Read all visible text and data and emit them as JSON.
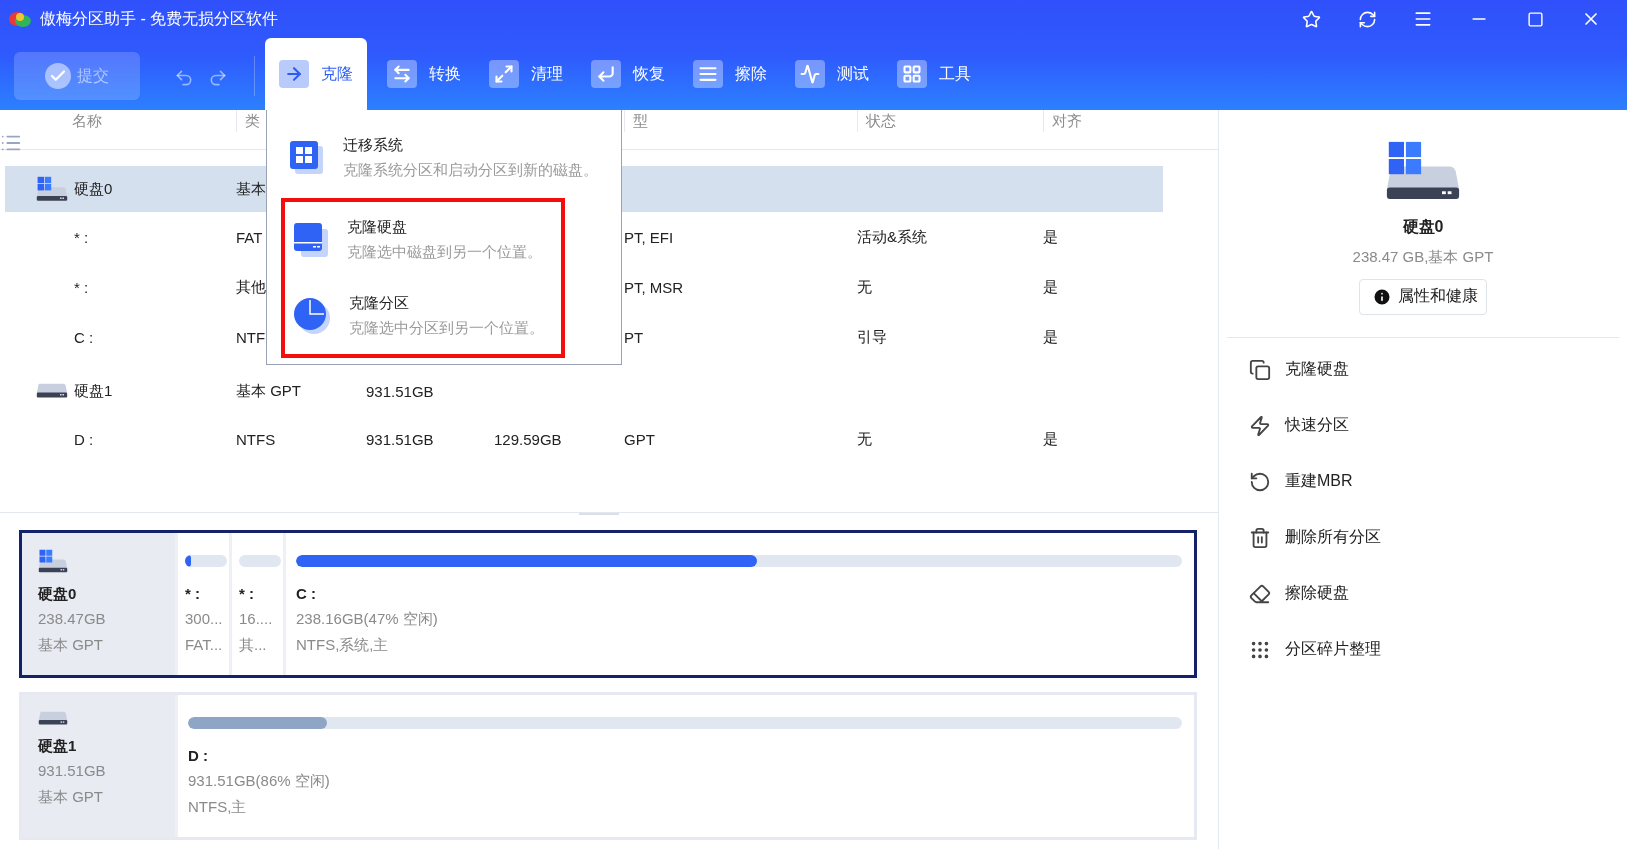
{
  "window": {
    "title": "傲梅分区助手 - 免费无损分区软件"
  },
  "toolbar": {
    "submit": {
      "label": "提交",
      "disabled": true
    },
    "tabs": [
      {
        "label": "克隆",
        "selected": true
      },
      {
        "label": "转换",
        "selected": false
      },
      {
        "label": "清理",
        "selected": false
      },
      {
        "label": "恢复",
        "selected": false
      },
      {
        "label": "擦除",
        "selected": false
      },
      {
        "label": "测试",
        "selected": false
      },
      {
        "label": "工具",
        "selected": false
      }
    ]
  },
  "clone_menu": {
    "items": [
      {
        "title": "迁移系统",
        "description": "克隆系统分区和启动分区到新的磁盘。",
        "highlighted": false
      },
      {
        "title": "克隆硬盘",
        "description": "克隆选中磁盘到另一个位置。",
        "highlighted": true
      },
      {
        "title": "克隆分区",
        "description": "克隆选中分区到另一个位置。",
        "highlighted": true
      }
    ]
  },
  "table": {
    "header": {
      "name": "名称",
      "type": "类",
      "fs": "型",
      "status": "状态",
      "align": "对齐"
    },
    "rows": [
      {
        "kind": "disk",
        "system": true,
        "selected": true,
        "name": "硬盘0",
        "type": "基本"
      },
      {
        "kind": "partition",
        "selected": false,
        "name": "* :",
        "type": "FAT",
        "fs": "PT, EFI",
        "status": "活动&系统",
        "align": "是"
      },
      {
        "kind": "partition",
        "selected": false,
        "name": "* :",
        "type": "其他",
        "fs": "PT, MSR",
        "status": "无",
        "align": "是"
      },
      {
        "kind": "partition",
        "selected": false,
        "name": "C :",
        "type": "NTF",
        "fs": "PT",
        "status": "引导",
        "align": "是"
      },
      {
        "kind": "disk",
        "system": false,
        "selected": false,
        "name": "硬盘1",
        "type": "基本 GPT",
        "capacity": "931.51GB"
      },
      {
        "kind": "partition",
        "selected": false,
        "name": "D :",
        "type": "NTFS",
        "capacity": "931.51GB",
        "used": "129.59GB",
        "fs": "GPT",
        "status": "无",
        "align": "是"
      }
    ]
  },
  "disk_map": [
    {
      "name": "硬盘0",
      "size": "238.47GB",
      "type": "基本 GPT",
      "system": true,
      "selected": true,
      "partitions": [
        {
          "kind": "small",
          "name": "* :",
          "size": "300...",
          "info": "FAT...",
          "level": 0.15
        },
        {
          "kind": "small",
          "name": "* :",
          "size": "16....",
          "info": "其..."
        },
        {
          "kind": "main",
          "name": "C :",
          "size": "238.16GB(47% 空闲)",
          "info": "NTFS,系统,主",
          "level": 0.52
        }
      ]
    },
    {
      "name": "硬盘1",
      "size": "931.51GB",
      "type": "基本 GPT",
      "system": false,
      "selected": false,
      "partitions": [
        {
          "kind": "main",
          "name": "D :",
          "size": "931.51GB(86% 空闲)",
          "info": "NTFS,主",
          "level": 0.14
        }
      ]
    }
  ],
  "details": {
    "name": "硬盘0",
    "summary": "238.47 GB,基本 GPT",
    "button": "属性和健康",
    "actions": [
      {
        "label": "克隆硬盘"
      },
      {
        "label": "快速分区"
      },
      {
        "label": "重建MBR"
      },
      {
        "label": "删除所有分区"
      },
      {
        "label": "擦除硬盘"
      },
      {
        "label": "分区碎片整理"
      }
    ]
  }
}
